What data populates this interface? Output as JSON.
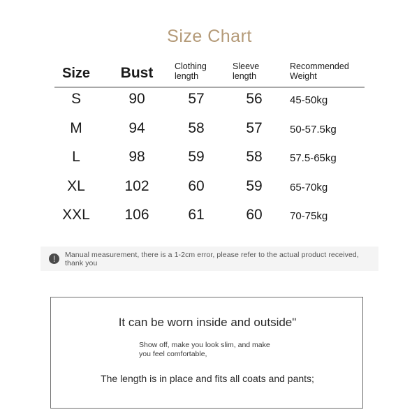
{
  "title": "Size Chart",
  "accent_color": "#b49a78",
  "table": {
    "headers": {
      "size": "Size",
      "bust": "Bust",
      "clothing_length": "Clothing\nlength",
      "clothing_length_line1": "Clothing",
      "clothing_length_line2": "length",
      "sleeve_length_line1": "Sleeve",
      "sleeve_length_line2": "length",
      "recommended_weight_line1": "Recommended",
      "recommended_weight_line2": "Weight"
    },
    "rows": [
      {
        "size": "S",
        "bust": "90",
        "clothing_length": "57",
        "sleeve_length": "56",
        "recommended_weight": "45-50kg"
      },
      {
        "size": "M",
        "bust": "94",
        "clothing_length": "58",
        "sleeve_length": "57",
        "recommended_weight": "50-57.5kg"
      },
      {
        "size": "L",
        "bust": "98",
        "clothing_length": "59",
        "sleeve_length": "58",
        "recommended_weight": "57.5-65kg"
      },
      {
        "size": "XL",
        "bust": "102",
        "clothing_length": "60",
        "sleeve_length": "59",
        "recommended_weight": "65-70kg"
      },
      {
        "size": "XXL",
        "bust": "106",
        "clothing_length": "61",
        "sleeve_length": "60",
        "recommended_weight": "70-75kg"
      }
    ]
  },
  "notice": {
    "icon": "exclamation-circle-icon",
    "text": "Manual measurement, there is a 1-2cm error, please refer to the actual product received, thank you"
  },
  "description": {
    "headline": "It can be worn inside and outside\"",
    "sub_line1": "Show off, make you look slim, and make",
    "sub_line2": "you feel comfortable,",
    "footer": "The length is in place and fits all coats and pants;"
  }
}
